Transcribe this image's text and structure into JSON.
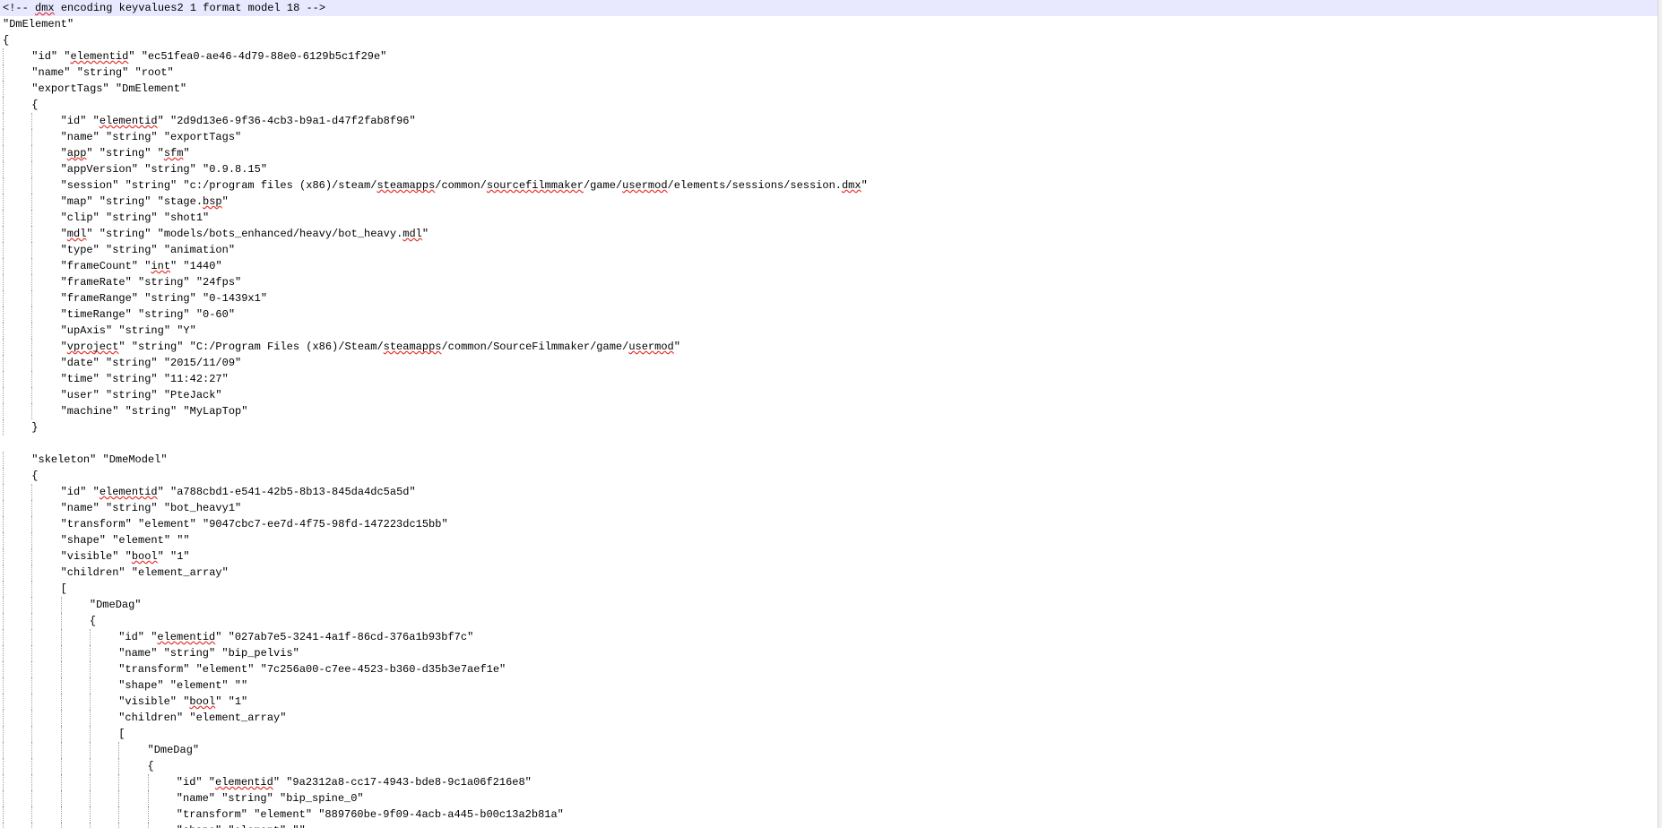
{
  "editor": {
    "current_line_bg": "#e8e8ff",
    "lines": [
      {
        "indent": 0,
        "current": true,
        "segments": [
          "<!-- ",
          {
            "s": "dmx"
          },
          " encoding keyvalues2 1 format model 18 -->"
        ]
      },
      {
        "indent": 0,
        "segments": [
          "\"DmElement\""
        ]
      },
      {
        "indent": 0,
        "segments": [
          "{"
        ]
      },
      {
        "indent": 1,
        "segments": [
          "\"id\" \"",
          {
            "s": "elementid"
          },
          "\" \"ec51fea0-ae46-4d79-88e0-6129b5c1f29e\""
        ]
      },
      {
        "indent": 1,
        "segments": [
          "\"name\" \"string\" \"root\""
        ]
      },
      {
        "indent": 1,
        "segments": [
          "\"exportTags\" \"DmElement\""
        ]
      },
      {
        "indent": 1,
        "segments": [
          "{"
        ]
      },
      {
        "indent": 2,
        "segments": [
          "\"id\" \"",
          {
            "s": "elementid"
          },
          "\" \"2d9d13e6-9f36-4cb3-b9a1-d47f2fab8f96\""
        ]
      },
      {
        "indent": 2,
        "segments": [
          "\"name\" \"string\" \"exportTags\""
        ]
      },
      {
        "indent": 2,
        "segments": [
          "\"",
          {
            "s": "app"
          },
          "\" \"string\" \"",
          {
            "s": "sfm"
          },
          "\""
        ]
      },
      {
        "indent": 2,
        "segments": [
          "\"appVersion\" \"string\" \"0.9.8.15\""
        ]
      },
      {
        "indent": 2,
        "segments": [
          "\"session\" \"string\" \"c:/program files (x86)/steam/",
          {
            "s": "steamapps"
          },
          "/common/",
          {
            "s": "sourcefilmmaker"
          },
          "/game/",
          {
            "s": "usermod"
          },
          "/elements/sessions/session.",
          {
            "s": "dmx"
          },
          "\""
        ]
      },
      {
        "indent": 2,
        "segments": [
          "\"map\" \"string\" \"stage.",
          {
            "s": "bsp"
          },
          "\""
        ]
      },
      {
        "indent": 2,
        "segments": [
          "\"clip\" \"string\" \"shot1\""
        ]
      },
      {
        "indent": 2,
        "segments": [
          "\"",
          {
            "s": "mdl"
          },
          "\" \"string\" \"models/bots_enhanced/heavy/bot_heavy.",
          {
            "s": "mdl"
          },
          "\""
        ]
      },
      {
        "indent": 2,
        "segments": [
          "\"type\" \"string\" \"animation\""
        ]
      },
      {
        "indent": 2,
        "segments": [
          "\"frameCount\" \"",
          {
            "s": "int"
          },
          "\" \"1440\""
        ]
      },
      {
        "indent": 2,
        "segments": [
          "\"frameRate\" \"string\" \"24fps\""
        ]
      },
      {
        "indent": 2,
        "segments": [
          "\"frameRange\" \"string\" \"0-1439x1\""
        ]
      },
      {
        "indent": 2,
        "segments": [
          "\"timeRange\" \"string\" \"0-60\""
        ]
      },
      {
        "indent": 2,
        "segments": [
          "\"upAxis\" \"string\" \"Y\""
        ]
      },
      {
        "indent": 2,
        "segments": [
          "\"",
          {
            "s": "vproject"
          },
          "\" \"string\" \"C:/Program Files (x86)/Steam/",
          {
            "s": "steamapps"
          },
          "/common/SourceFilmmaker/game/",
          {
            "s": "usermod"
          },
          "\""
        ]
      },
      {
        "indent": 2,
        "segments": [
          "\"date\" \"string\" \"2015/11/09\""
        ]
      },
      {
        "indent": 2,
        "segments": [
          "\"time\" \"string\" \"11:42:27\""
        ]
      },
      {
        "indent": 2,
        "segments": [
          "\"user\" \"string\" \"PteJack\""
        ]
      },
      {
        "indent": 2,
        "segments": [
          "\"machine\" \"string\" \"MyLapTop\""
        ]
      },
      {
        "indent": 1,
        "segments": [
          "}"
        ]
      },
      {
        "indent": 0,
        "segments": [
          ""
        ]
      },
      {
        "indent": 1,
        "segments": [
          "\"skeleton\" \"DmeModel\""
        ]
      },
      {
        "indent": 1,
        "segments": [
          "{"
        ]
      },
      {
        "indent": 2,
        "segments": [
          "\"id\" \"",
          {
            "s": "elementid"
          },
          "\" \"a788cbd1-e541-42b5-8b13-845da4dc5a5d\""
        ]
      },
      {
        "indent": 2,
        "segments": [
          "\"name\" \"string\" \"bot_heavy1\""
        ]
      },
      {
        "indent": 2,
        "segments": [
          "\"transform\" \"element\" \"9047cbc7-ee7d-4f75-98fd-147223dc15bb\""
        ]
      },
      {
        "indent": 2,
        "segments": [
          "\"shape\" \"element\" \"\""
        ]
      },
      {
        "indent": 2,
        "segments": [
          "\"visible\" \"",
          {
            "s": "bool"
          },
          "\" \"1\""
        ]
      },
      {
        "indent": 2,
        "segments": [
          "\"children\" \"element_array\""
        ]
      },
      {
        "indent": 2,
        "segments": [
          "["
        ]
      },
      {
        "indent": 3,
        "segments": [
          "\"DmeDag\""
        ]
      },
      {
        "indent": 3,
        "segments": [
          "{"
        ]
      },
      {
        "indent": 4,
        "segments": [
          "\"id\" \"",
          {
            "s": "elementid"
          },
          "\" \"027ab7e5-3241-4a1f-86cd-376a1b93bf7c\""
        ]
      },
      {
        "indent": 4,
        "segments": [
          "\"name\" \"string\" \"bip_pelvis\""
        ]
      },
      {
        "indent": 4,
        "segments": [
          "\"transform\" \"element\" \"7c256a00-c7ee-4523-b360-d35b3e7aef1e\""
        ]
      },
      {
        "indent": 4,
        "segments": [
          "\"shape\" \"element\" \"\""
        ]
      },
      {
        "indent": 4,
        "segments": [
          "\"visible\" \"",
          {
            "s": "bool"
          },
          "\" \"1\""
        ]
      },
      {
        "indent": 4,
        "segments": [
          "\"children\" \"element_array\""
        ]
      },
      {
        "indent": 4,
        "segments": [
          "["
        ]
      },
      {
        "indent": 5,
        "segments": [
          "\"DmeDag\""
        ]
      },
      {
        "indent": 5,
        "segments": [
          "{"
        ]
      },
      {
        "indent": 6,
        "segments": [
          "\"id\" \"",
          {
            "s": "elementid"
          },
          "\" \"9a2312a8-cc17-4943-bde8-9c1a06f216e8\""
        ]
      },
      {
        "indent": 6,
        "segments": [
          "\"name\" \"string\" \"bip_spine_0\""
        ]
      },
      {
        "indent": 6,
        "segments": [
          "\"transform\" \"element\" \"889760be-9f09-4acb-a445-b00c13a2b81a\""
        ]
      },
      {
        "indent": 6,
        "segments": [
          "\"shape\" \"element\" \"\""
        ]
      }
    ]
  }
}
